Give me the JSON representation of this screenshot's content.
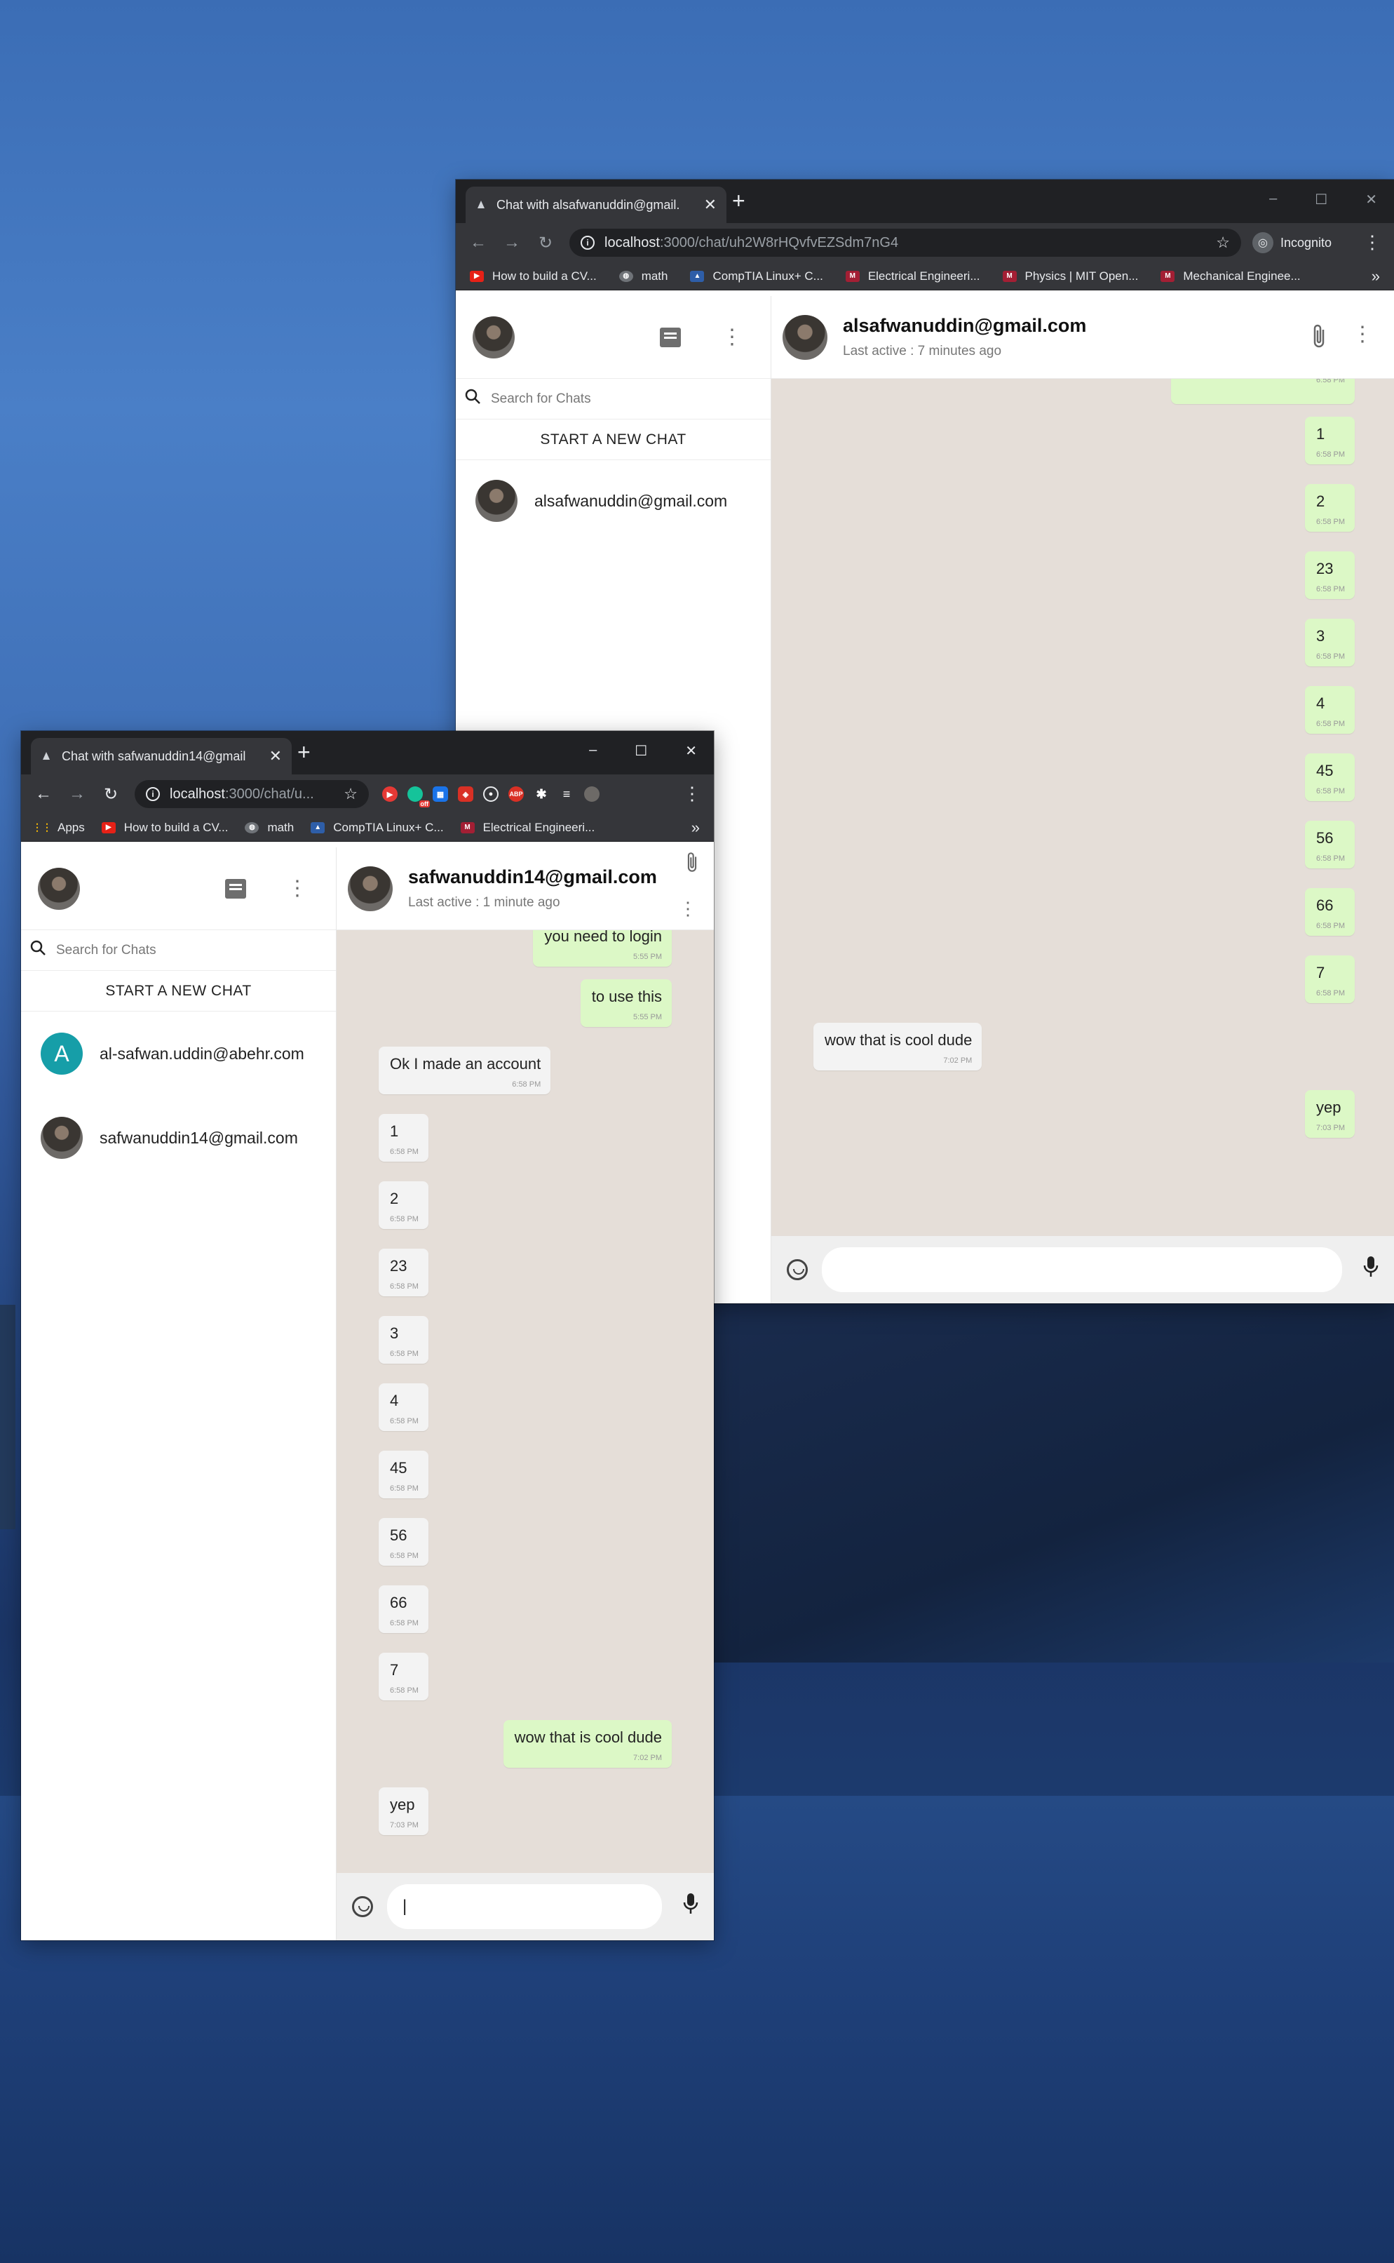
{
  "window_back": {
    "tab_title": "Chat with alsafwanuddin@gmail.",
    "url_host": "localhost",
    "url_path": ":3000/chat/uh2W8rHQvfvEZSdm7nG4",
    "incognito": "Incognito",
    "bookmarks": [
      "How to build a CV...",
      "math",
      "CompTIA Linux+ C...",
      "Electrical Engineeri...",
      "Physics | MIT Open...",
      "Mechanical Enginee..."
    ],
    "bookmarks_more": "»",
    "sidebar": {
      "search_placeholder": "Search for Chats",
      "new_chat": "START A NEW CHAT",
      "contacts": [
        "alsafwanuddin@gmail.com"
      ]
    },
    "chat": {
      "name": "alsafwanuddin@gmail.com",
      "last_active": "Last active : 7 minutes ago",
      "messages": [
        {
          "text": "",
          "time": "6:58 PM",
          "dir": "out"
        },
        {
          "text": "1",
          "time": "6:58 PM",
          "dir": "out"
        },
        {
          "text": "2",
          "time": "6:58 PM",
          "dir": "out"
        },
        {
          "text": "23",
          "time": "6:58 PM",
          "dir": "out"
        },
        {
          "text": "3",
          "time": "6:58 PM",
          "dir": "out"
        },
        {
          "text": "4",
          "time": "6:58 PM",
          "dir": "out"
        },
        {
          "text": "45",
          "time": "6:58 PM",
          "dir": "out"
        },
        {
          "text": "56",
          "time": "6:58 PM",
          "dir": "out"
        },
        {
          "text": "66",
          "time": "6:58 PM",
          "dir": "out"
        },
        {
          "text": "7",
          "time": "6:58 PM",
          "dir": "out"
        },
        {
          "text": "wow that is cool dude",
          "time": "7:02 PM",
          "dir": "in"
        },
        {
          "text": "yep",
          "time": "7:03 PM",
          "dir": "out"
        }
      ],
      "input_value": ""
    }
  },
  "window_front": {
    "tab_title": "Chat with safwanuddin14@gmail",
    "url_host": "localhost",
    "url_path": ":3000/chat/u...",
    "bookmarks": [
      "Apps",
      "How to build a CV...",
      "math",
      "CompTIA Linux+ C...",
      "Electrical Engineeri..."
    ],
    "bookmarks_more": "»",
    "extensions": [
      "off",
      "ABP"
    ],
    "sidebar": {
      "search_placeholder": "Search for Chats",
      "new_chat": "START A NEW CHAT",
      "contacts": [
        {
          "name": "al-safwan.uddin@abehr.com",
          "initial": "A"
        },
        {
          "name": "safwanuddin14@gmail.com",
          "initial": ""
        }
      ]
    },
    "chat": {
      "name": "safwanuddin14@gmail.com",
      "last_active": "Last active : 1 minute ago",
      "messages": [
        {
          "text": "you need to login",
          "time": "5:55 PM",
          "dir": "out"
        },
        {
          "text": "to use this",
          "time": "5:55 PM",
          "dir": "out"
        },
        {
          "text": "Ok I made an account",
          "time": "6:58 PM",
          "dir": "in"
        },
        {
          "text": "1",
          "time": "6:58 PM",
          "dir": "in"
        },
        {
          "text": "2",
          "time": "6:58 PM",
          "dir": "in"
        },
        {
          "text": "23",
          "time": "6:58 PM",
          "dir": "in"
        },
        {
          "text": "3",
          "time": "6:58 PM",
          "dir": "in"
        },
        {
          "text": "4",
          "time": "6:58 PM",
          "dir": "in"
        },
        {
          "text": "45",
          "time": "6:58 PM",
          "dir": "in"
        },
        {
          "text": "56",
          "time": "6:58 PM",
          "dir": "in"
        },
        {
          "text": "66",
          "time": "6:58 PM",
          "dir": "in"
        },
        {
          "text": "7",
          "time": "6:58 PM",
          "dir": "in"
        },
        {
          "text": "wow that is cool dude",
          "time": "7:02 PM",
          "dir": "out"
        },
        {
          "text": "yep",
          "time": "7:03 PM",
          "dir": "in"
        }
      ],
      "input_value": "|"
    }
  },
  "icons": {
    "back": "←",
    "forward": "→",
    "reload": "↻",
    "star": "☆",
    "kebab": "⋮",
    "new_tab": "+",
    "close_tab": "✕",
    "minimize": "–",
    "maximize": "☐",
    "close": "✕",
    "search": "⚲",
    "clip": "📎",
    "mic": "🎤",
    "extension": "✱"
  },
  "colors": {
    "outgoing_bubble": "#dcf8c6",
    "incoming_bubble": "#f3f3f3",
    "chat_background": "#e5ded8",
    "avatar_letter_bg": "#169ea8"
  }
}
